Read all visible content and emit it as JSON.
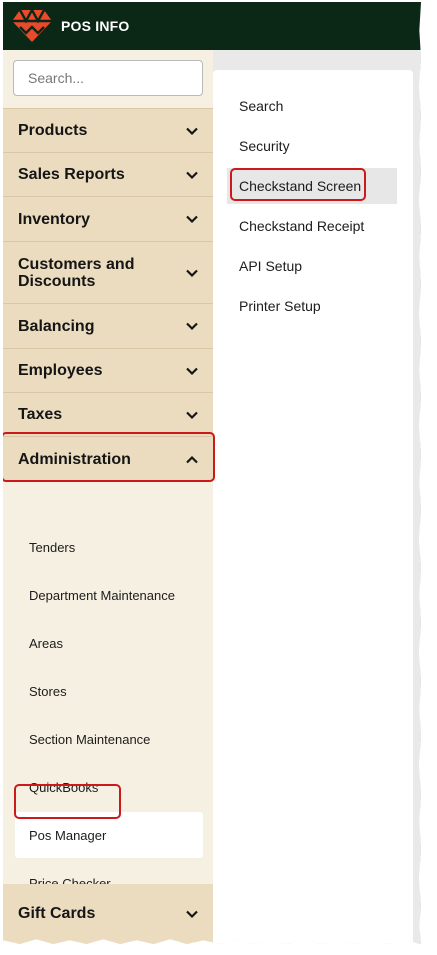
{
  "app": {
    "title": "POS INFO",
    "logo_icon": "pos-logo-icon",
    "brand_color": "#e84a2b"
  },
  "search": {
    "placeholder": "Search..."
  },
  "menu": [
    {
      "label": "Products",
      "expanded": false
    },
    {
      "label": "Sales Reports",
      "expanded": false
    },
    {
      "label": "Inventory",
      "expanded": false
    },
    {
      "label": "Customers and Discounts",
      "expanded": false
    },
    {
      "label": "Balancing",
      "expanded": false
    },
    {
      "label": "Employees",
      "expanded": false
    },
    {
      "label": "Taxes",
      "expanded": false
    },
    {
      "label": "Administration",
      "expanded": true
    }
  ],
  "administration_items": [
    {
      "label": "Tenders"
    },
    {
      "label": "Department Maintenance"
    },
    {
      "label": "Areas"
    },
    {
      "label": "Stores"
    },
    {
      "label": "Section Maintenance"
    },
    {
      "label": "QuickBooks"
    },
    {
      "label": "Pos Manager",
      "selected": true
    },
    {
      "label": "Price Checker"
    }
  ],
  "bottom_menu": {
    "label": "Gift Cards",
    "expanded": false
  },
  "pos_manager_items": [
    {
      "label": "Search"
    },
    {
      "label": "Security"
    },
    {
      "label": "Checkstand Screen",
      "active": true
    },
    {
      "label": "Checkstand Receipt"
    },
    {
      "label": "API Setup"
    },
    {
      "label": "Printer Setup"
    }
  ],
  "colors": {
    "topbar": "#0b2716",
    "sidebar_header": "#ebdcc0",
    "sidebar_bg": "#f6f0e3",
    "highlight": "#cc1a1a"
  }
}
